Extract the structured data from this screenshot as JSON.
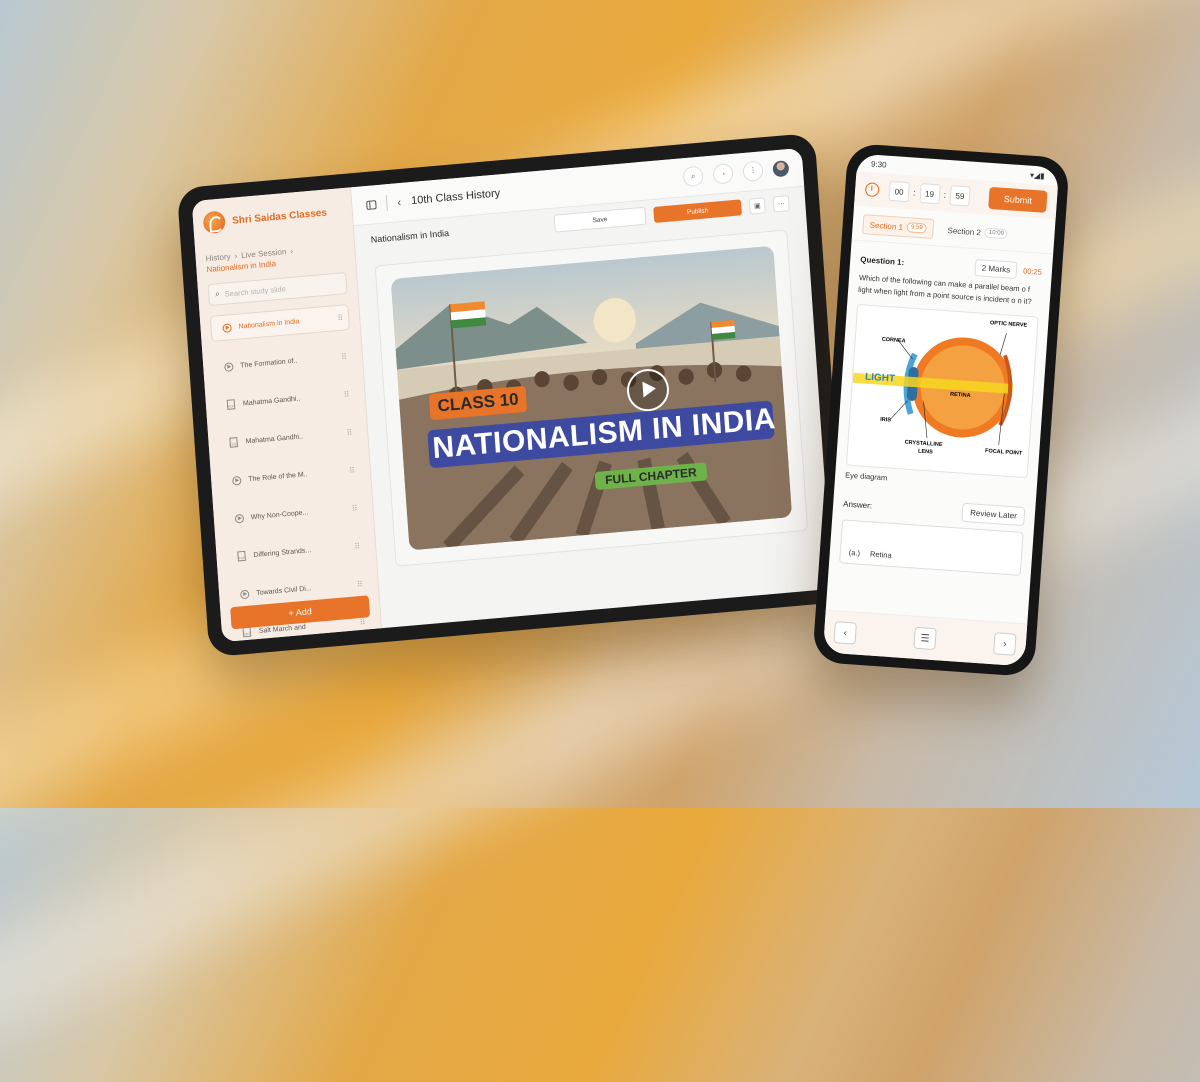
{
  "tablet": {
    "brand": "Shri Saidas Classes",
    "breadcrumb": {
      "root": "History",
      "middle": "Live Session",
      "current": "Nationalism in India"
    },
    "search_placeholder": "Search study slide",
    "sidebar_items": [
      {
        "label": "Nationalism in India",
        "icon": "play-icon",
        "active": true
      },
      {
        "label": "The Formation of..",
        "icon": "play-icon"
      },
      {
        "label": "Mahatma Gandhi..",
        "icon": "pdf-icon"
      },
      {
        "label": "Mahatma Gandhi..",
        "icon": "doc-icon"
      },
      {
        "label": "The Role of the M..",
        "icon": "play-icon"
      },
      {
        "label": "Why Non-Coope...",
        "icon": "play-icon"
      },
      {
        "label": "Differing Strands...",
        "icon": "pdf-icon"
      },
      {
        "label": "Towards Civil  Di...",
        "icon": "play-icon"
      },
      {
        "label": "Salt March and",
        "icon": "doc-icon"
      }
    ],
    "add_label": "+ Add",
    "title": "10th Class History",
    "lesson_title": "Nationalism in India",
    "save_label": "Save",
    "publish_label": "Publish",
    "thumbnail": {
      "class_label": "CLASS 10",
      "title": "NATIONALISM IN INDIA",
      "subtitle": "FULL CHAPTER"
    },
    "accent_color": "#e8742a"
  },
  "phone": {
    "status_time": "9:30",
    "timer": {
      "hh": "00",
      "mm": "19",
      "ss": "59"
    },
    "submit_label": "Submit",
    "sections": [
      {
        "label": "Section 1",
        "time": "9:59",
        "active": true
      },
      {
        "label": "Section 2",
        "time": "10:00"
      }
    ],
    "question": {
      "label": "Question 1:",
      "marks": "2 Marks",
      "time": "00:25",
      "text": "Which of the following can make a parallel beam o f light when light from a point source is incident o n it?"
    },
    "diagram_labels": {
      "optic_nerve": "OPTIC NERVE",
      "cornea": "CORNEA",
      "light": "LIGHT",
      "retina": "RETINA",
      "iris": "IRIS",
      "lens": "CRYSTALLINE",
      "lens2": "LENS",
      "focal": "FOCAL POINT"
    },
    "caption": "Eye diagram",
    "answer_label": "Answer:",
    "review_label": "Review Later",
    "option_a": {
      "key": "(a.)",
      "text": "Retina"
    }
  }
}
